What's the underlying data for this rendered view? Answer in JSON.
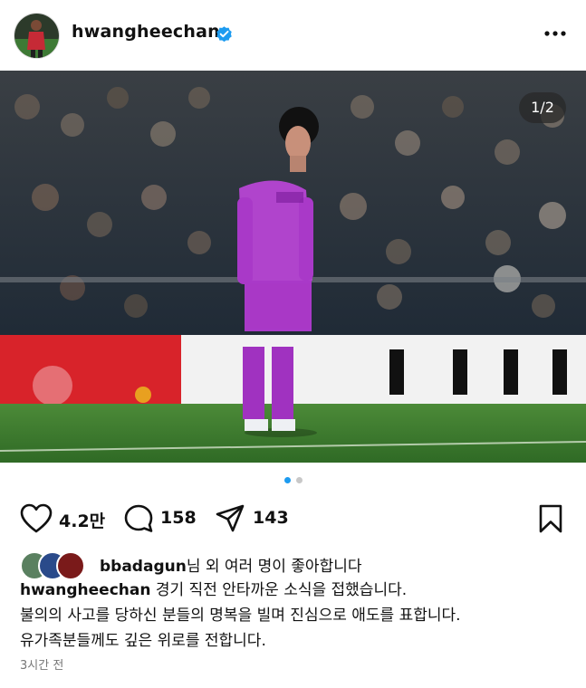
{
  "post": {
    "username": "hwangheechan",
    "verified": true,
    "slide_counter": "1/2",
    "slides_total": 2,
    "slide_current": 1
  },
  "icons": {
    "avatar": "profile-avatar",
    "verified": "verified-badge-icon",
    "more": "more-options-icon",
    "like": "heart-icon",
    "comment": "comment-bubble-icon",
    "share": "paper-plane-icon",
    "save": "bookmark-icon"
  },
  "actions": {
    "likes_count": "4.2만",
    "comments_count": "158",
    "shares_count": "143"
  },
  "likes": {
    "liked_by_user": "bbadagun",
    "liked_by_rest": "님 외 여러 명이 좋아합니다"
  },
  "caption": {
    "author": "hwangheechan",
    "line1": "경기 직전 안타까운 소식을 접했습니다.",
    "line2": "불의의 사고를 당하신 분들의 명복을 빌며 진심으로 애도를 표합니다.",
    "line3": "유가족분들께도 깊은 위로를 전합니다."
  },
  "timestamp": "3시간 전",
  "colors": {
    "accent_blue": "#1d9bf0",
    "kit_purple": "#9b2fb0",
    "pitch_green": "#3f7d2e",
    "board_red": "#d8232a"
  }
}
